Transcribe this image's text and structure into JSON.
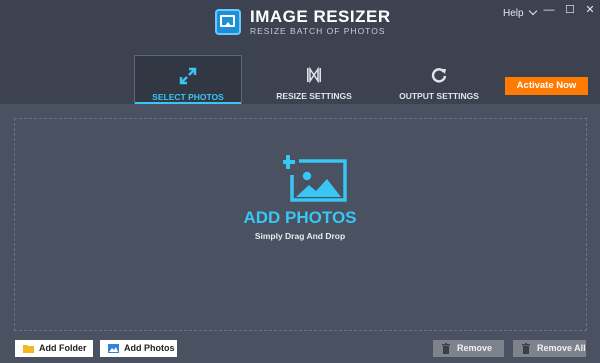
{
  "app": {
    "title": "IMAGE RESIZER",
    "subtitle": "RESIZE BATCH OF PHOTOS",
    "logo_icon": "image-resizer-logo-icon"
  },
  "window": {
    "help_label": "Help",
    "minimize_glyph": "—",
    "maximize_glyph": "☐",
    "close_glyph": "✕"
  },
  "tabs": [
    {
      "label": "SELECT PHOTOS",
      "icon": "expand-arrows-icon",
      "active": true
    },
    {
      "label": "RESIZE SETTINGS",
      "icon": "resize-icon",
      "active": false
    },
    {
      "label": "OUTPUT SETTINGS",
      "icon": "refresh-icon",
      "active": false
    }
  ],
  "activate_label": "Activate Now",
  "dropzone": {
    "title": "ADD PHOTOS",
    "subtitle": "Simply Drag And Drop",
    "icon": "add-photo-icon"
  },
  "buttons": {
    "add_folder": "Add Folder",
    "add_photos": "Add Photos",
    "remove": "Remove",
    "remove_all": "Remove All"
  },
  "colors": {
    "accent": "#39c6f4",
    "activate": "#ff7a00",
    "background": "#4a5161",
    "header": "#3c4250"
  }
}
